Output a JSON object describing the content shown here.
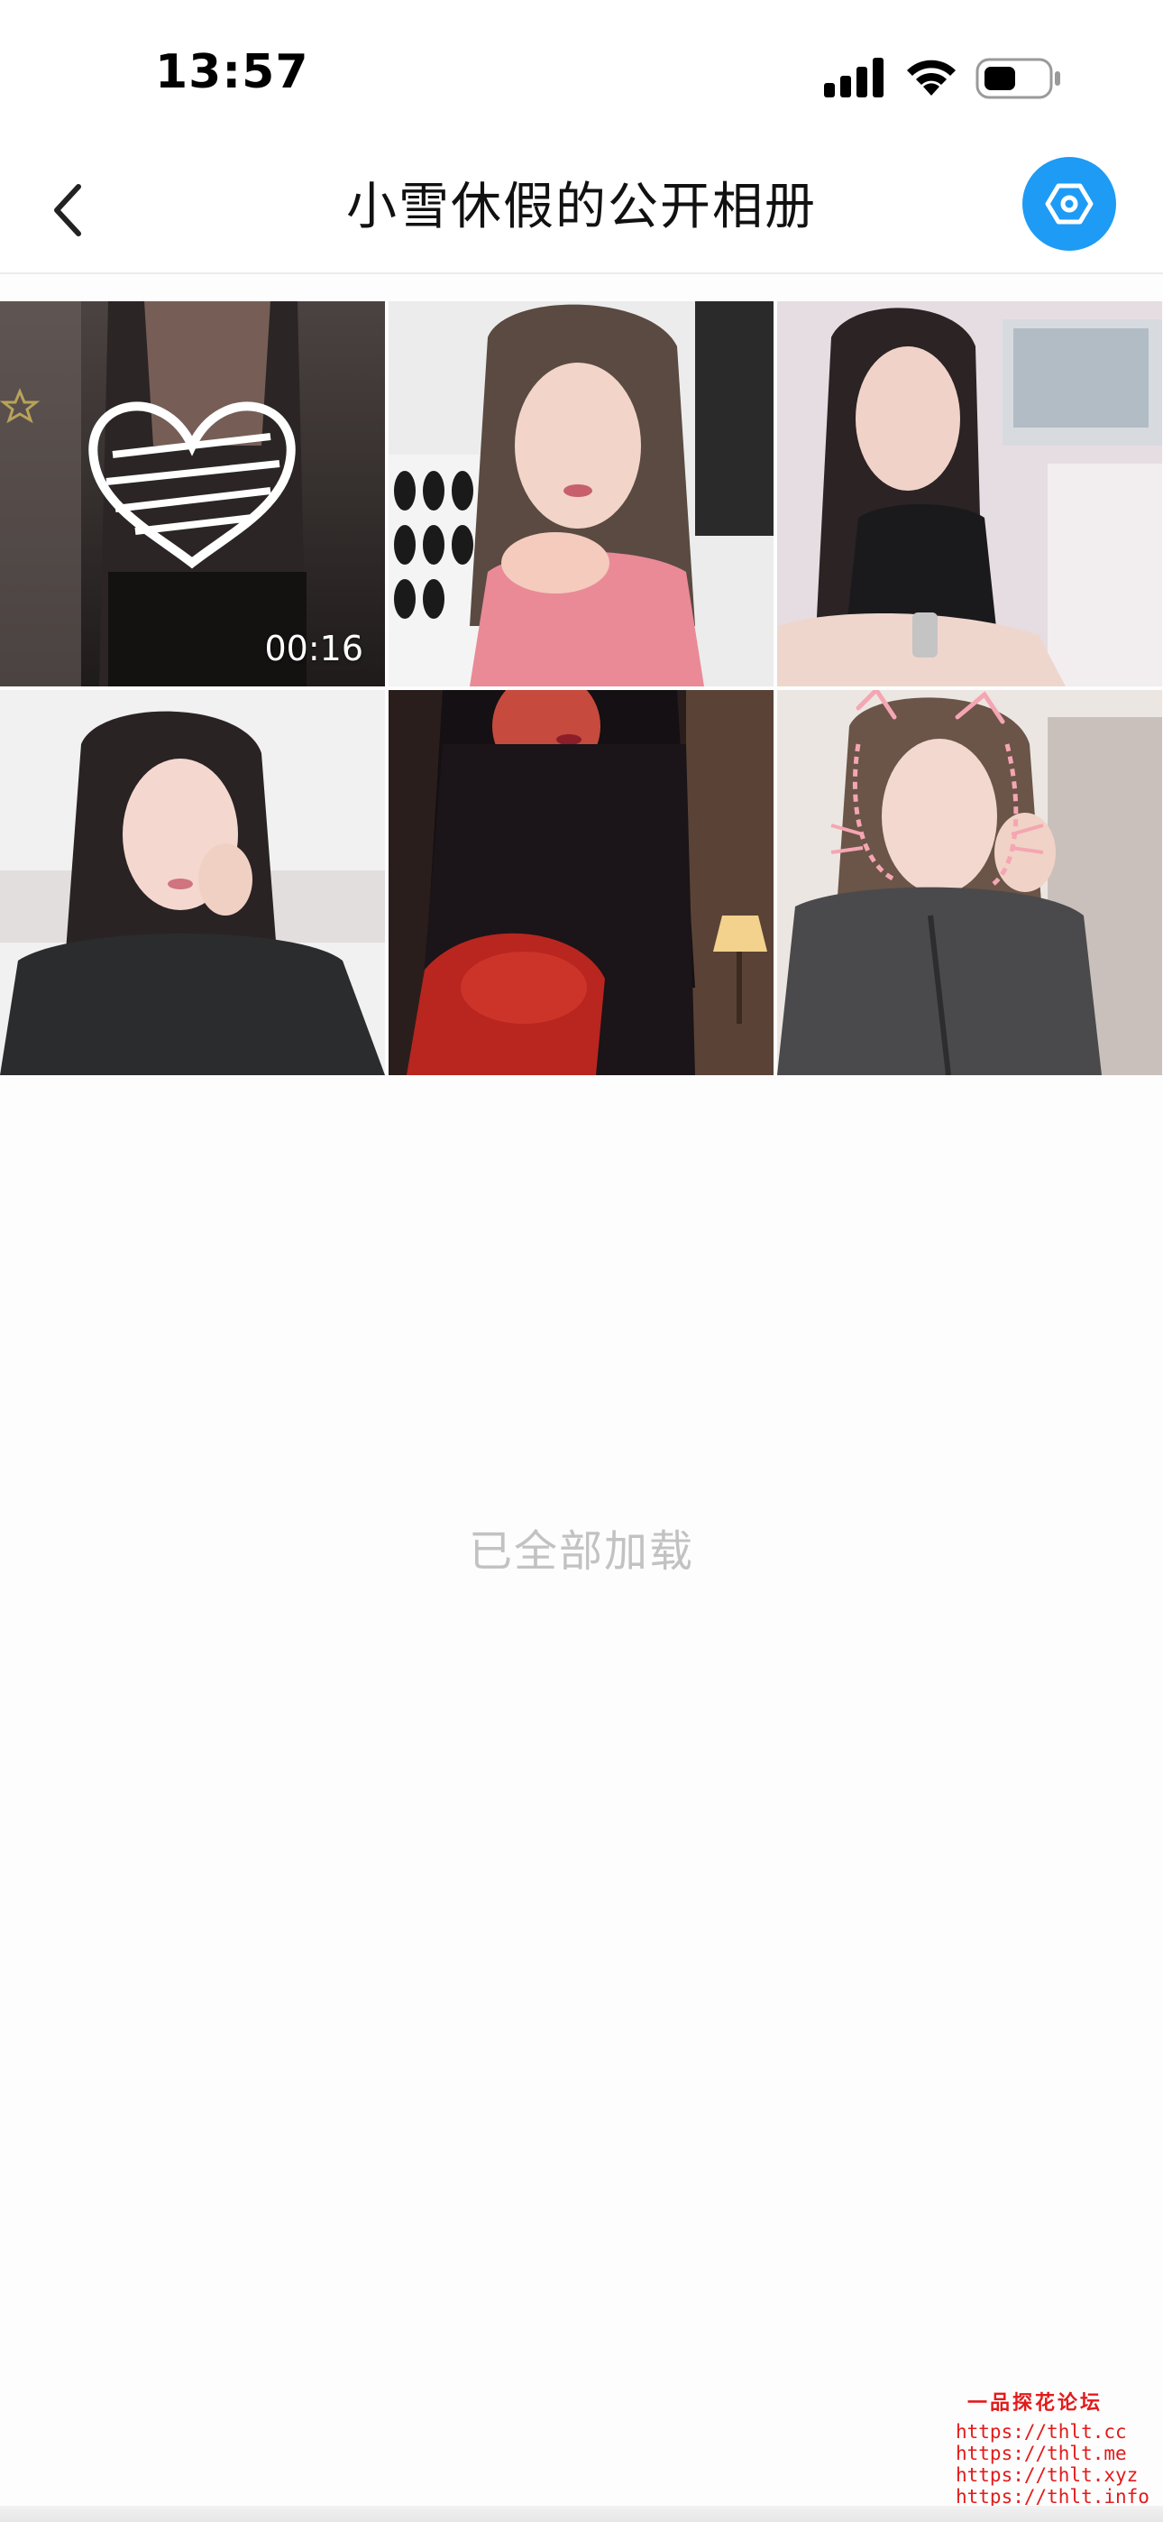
{
  "status_bar": {
    "time": "13:57"
  },
  "nav": {
    "title": "小雪休假的公开相册",
    "accent_color": "#1e9bf5",
    "back_icon": "chevron-left-icon",
    "settings_icon": "hexagon-settings-icon"
  },
  "photos": [
    {
      "type": "video",
      "duration": "00:16"
    },
    {
      "type": "image"
    },
    {
      "type": "image"
    },
    {
      "type": "image"
    },
    {
      "type": "image"
    },
    {
      "type": "image"
    }
  ],
  "footer": {
    "load_status": "已全部加载"
  },
  "watermark": {
    "title": "一品探花论坛",
    "urls": [
      "https://thlt.cc",
      "https://thlt.me",
      "https://thlt.xyz",
      "https://thlt.info"
    ]
  }
}
